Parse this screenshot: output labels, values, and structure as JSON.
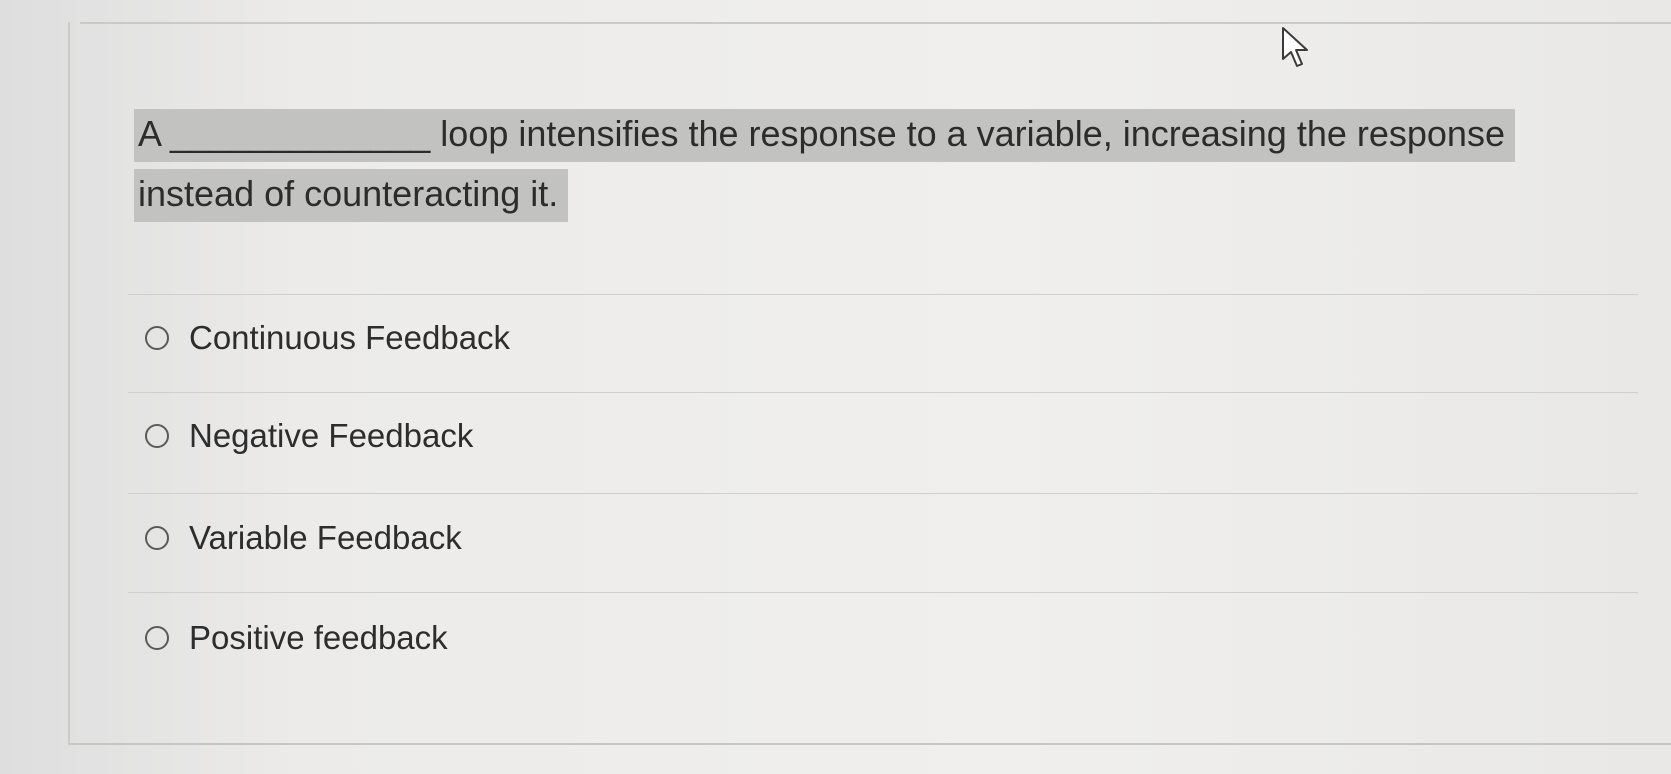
{
  "question": {
    "text": "A _____________ loop intensifies the response to a variable, increasing the response instead of counteracting it."
  },
  "options": [
    {
      "label": "Continuous Feedback",
      "selected": false
    },
    {
      "label": "Negative Feedback",
      "selected": false
    },
    {
      "label": "Variable Feedback",
      "selected": false
    },
    {
      "label": "Positive feedback",
      "selected": false
    }
  ],
  "cursor": {
    "icon": "arrow-pointer-icon"
  },
  "colors": {
    "background": "#e9e8e6",
    "highlight": "#c2c2c0",
    "text": "#2c2c2c"
  }
}
